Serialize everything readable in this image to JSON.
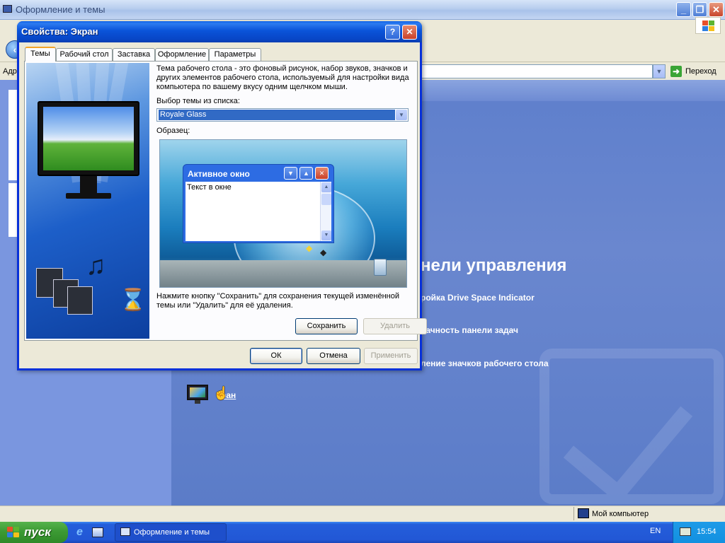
{
  "background_window": {
    "title": "Оформление и темы",
    "address_label": "Адр",
    "go_label": "Переход",
    "panel_heading": "нели управления",
    "links": [
      "ройка Drive Space Indicator",
      "рачность панели задач",
      "ление значков рабочего стола"
    ],
    "screen_link": "ран",
    "status_computer": "Мой компьютер"
  },
  "dialog": {
    "title": "Свойства: Экран",
    "help_glyph": "?",
    "close_glyph": "✕",
    "tabs": [
      {
        "label": "Темы",
        "active": true
      },
      {
        "label": "Рабочий стол",
        "active": false
      },
      {
        "label": "Заставка",
        "active": false
      },
      {
        "label": "Оформление",
        "active": false
      },
      {
        "label": "Параметры",
        "active": false
      }
    ],
    "description": "Тема рабочего стола - это фоновый рисунок, набор звуков, значков и других элементов рабочего стола, используемый для настройки вида компьютера по вашему вкусу одним щелчком мыши.",
    "select_label": "Выбор темы из списка:",
    "selected_theme": "Royale Glass",
    "sample_label": "Образец:",
    "preview_window": {
      "title": "Активное окно",
      "text": "Текст в окне"
    },
    "hint": "Нажмите кнопку \"Сохранить\" для сохранения текущей изменённой темы или \"Удалить\" для её удаления.",
    "buttons": {
      "save": "Сохранить",
      "delete": "Удалить",
      "ok": "ОК",
      "cancel": "Отмена",
      "apply": "Применить"
    }
  },
  "taskbar": {
    "start_label": "пуск",
    "task_title": "Оформление и темы",
    "language": "EN",
    "clock": "15:54"
  },
  "colors": {
    "taskbar_blue": "#245edb",
    "start_green": "#3c9a34",
    "dialog_title_blue": "#0a53d9",
    "panel_blue": "#5e7fcc",
    "selection_blue": "#316ac5"
  }
}
